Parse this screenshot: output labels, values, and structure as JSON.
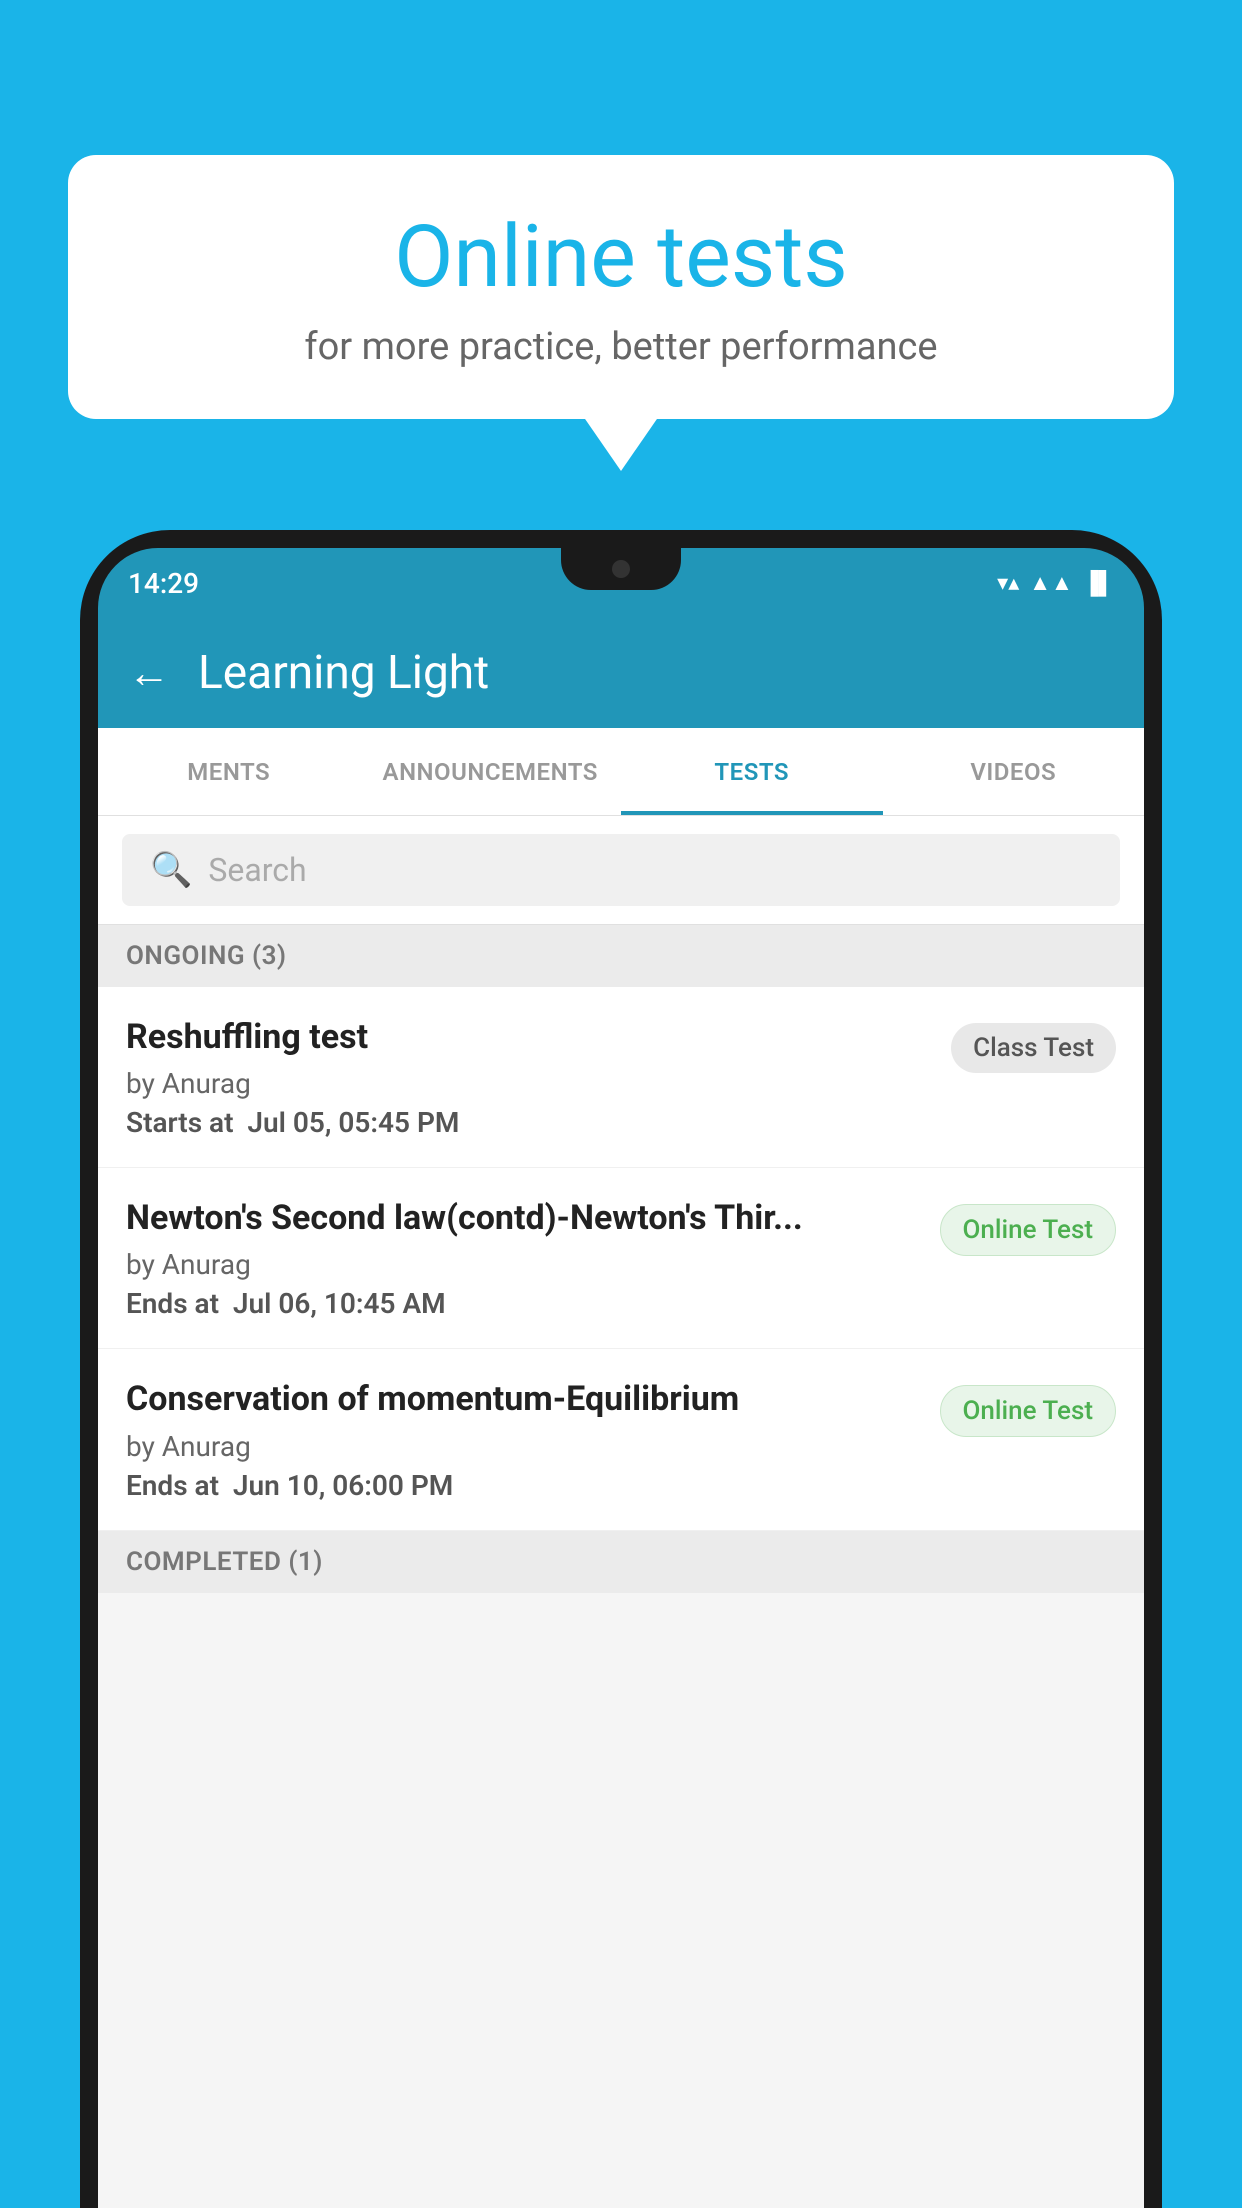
{
  "background": {
    "color": "#1ab4e8"
  },
  "speech_bubble": {
    "title": "Online tests",
    "subtitle": "for more practice, better performance"
  },
  "phone": {
    "status_bar": {
      "time": "14:29",
      "wifi": "▼",
      "signal": "▲",
      "battery": "▐"
    },
    "app_bar": {
      "back_label": "←",
      "title": "Learning Light"
    },
    "tabs": [
      {
        "label": "MENTS",
        "active": false
      },
      {
        "label": "ANNOUNCEMENTS",
        "active": false
      },
      {
        "label": "TESTS",
        "active": true
      },
      {
        "label": "VIDEOS",
        "active": false
      }
    ],
    "search": {
      "placeholder": "Search",
      "search_icon": "🔍"
    },
    "ongoing_section": {
      "header": "ONGOING (3)",
      "tests": [
        {
          "name": "Reshuffling test",
          "by": "by Anurag",
          "date_label": "Starts at",
          "date": "Jul 05, 05:45 PM",
          "badge": "Class Test",
          "badge_type": "class"
        },
        {
          "name": "Newton's Second law(contd)-Newton's Thir...",
          "by": "by Anurag",
          "date_label": "Ends at",
          "date": "Jul 06, 10:45 AM",
          "badge": "Online Test",
          "badge_type": "online"
        },
        {
          "name": "Conservation of momentum-Equilibrium",
          "by": "by Anurag",
          "date_label": "Ends at",
          "date": "Jun 10, 06:00 PM",
          "badge": "Online Test",
          "badge_type": "online"
        }
      ]
    },
    "completed_section": {
      "header": "COMPLETED (1)"
    }
  }
}
